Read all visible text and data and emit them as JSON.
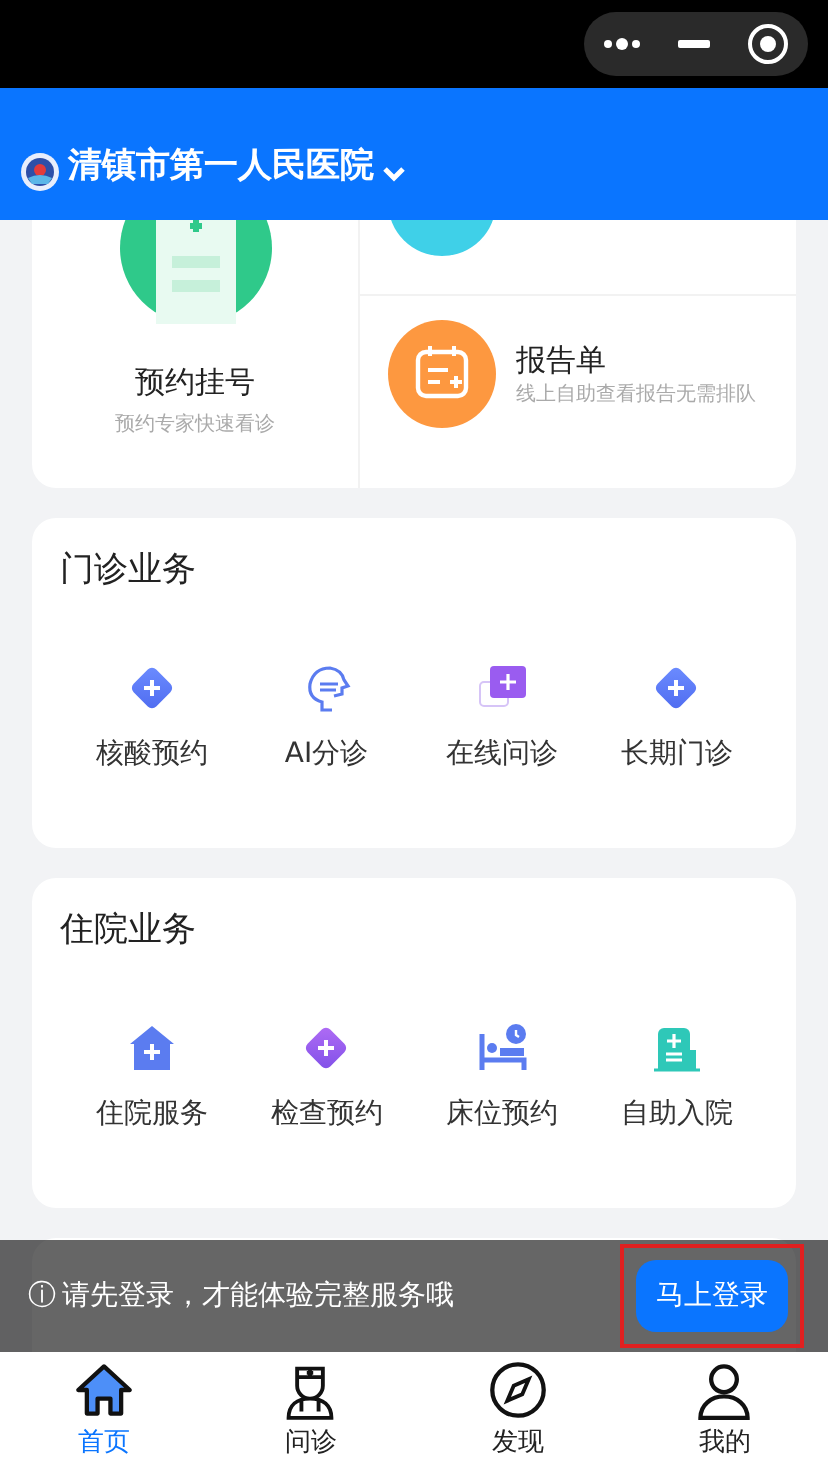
{
  "header": {
    "title": "清镇市第一人民医院"
  },
  "featured": {
    "main": {
      "title": "预约挂号",
      "subtitle": "预约专家快速看诊"
    },
    "side": {
      "title": "报告单",
      "subtitle": "线上自助查看报告无需排队"
    }
  },
  "sections": [
    {
      "title": "门诊业务",
      "items": [
        {
          "label": "核酸预约",
          "kind": "diamond"
        },
        {
          "label": "AI分诊",
          "kind": "face"
        },
        {
          "label": "在线问诊",
          "kind": "chat"
        },
        {
          "label": "长期门诊",
          "kind": "diamond"
        }
      ]
    },
    {
      "title": "住院业务",
      "items": [
        {
          "label": "住院服务",
          "kind": "house"
        },
        {
          "label": "检查预约",
          "kind": "diamond-purple"
        },
        {
          "label": "床位预约",
          "kind": "bed"
        },
        {
          "label": "自助入院",
          "kind": "admit"
        }
      ]
    }
  ],
  "login_bar": {
    "info_icon": "ⓘ",
    "message": "请先登录，才能体验完整服务哦",
    "button": "马上登录"
  },
  "tabs": [
    {
      "label": "首页",
      "kind": "home",
      "selected": true
    },
    {
      "label": "问诊",
      "kind": "doctor",
      "selected": false
    },
    {
      "label": "发现",
      "kind": "compass",
      "selected": false
    },
    {
      "label": "我的",
      "kind": "user",
      "selected": false
    }
  ]
}
